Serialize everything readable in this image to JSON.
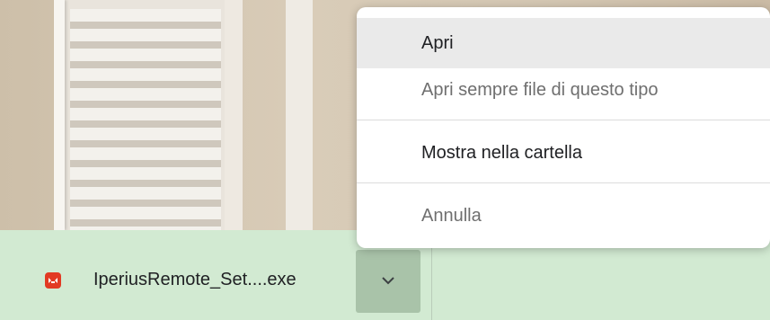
{
  "download": {
    "file_name": "IperiusRemote_Set....exe",
    "icon": "iperius-remote-icon",
    "dropdown_icon": "chevron-down-icon"
  },
  "menu": {
    "items": [
      {
        "label": "Apri",
        "state": "hover"
      },
      {
        "label": "Apri sempre file di questo tipo",
        "state": "normal"
      },
      {
        "label": "Mostra nella cartella",
        "state": "normal"
      },
      {
        "label": "Annulla",
        "state": "normal"
      }
    ]
  },
  "colors": {
    "download_bar": "#d2ead2",
    "dropdown_button": "#a9c3a9",
    "file_icon": "#e23a23",
    "menu_hover": "#eaeaea"
  }
}
